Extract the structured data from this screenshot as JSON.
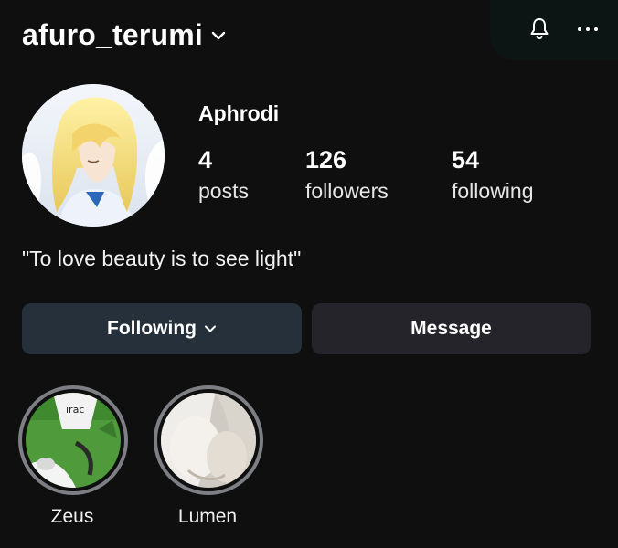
{
  "profile": {
    "username": "afuro_terumi",
    "display_name": "Aphrodi",
    "bio": "\"To love beauty is to see light\"",
    "stats": [
      {
        "value": "4",
        "label": "posts"
      },
      {
        "value": "126",
        "label": "followers"
      },
      {
        "value": "54",
        "label": "following"
      }
    ]
  },
  "actions": {
    "following_label": "Following",
    "message_label": "Message"
  },
  "highlights": [
    {
      "label": "Zeus"
    },
    {
      "label": "Lumen"
    }
  ],
  "icons": [
    "chevron-down-icon",
    "bell-icon",
    "more-icon"
  ],
  "colors": {
    "background": "#0f0f10",
    "following_button": "#25303a",
    "message_button": "#25242a",
    "highlight_ring": "#7d7f84"
  }
}
